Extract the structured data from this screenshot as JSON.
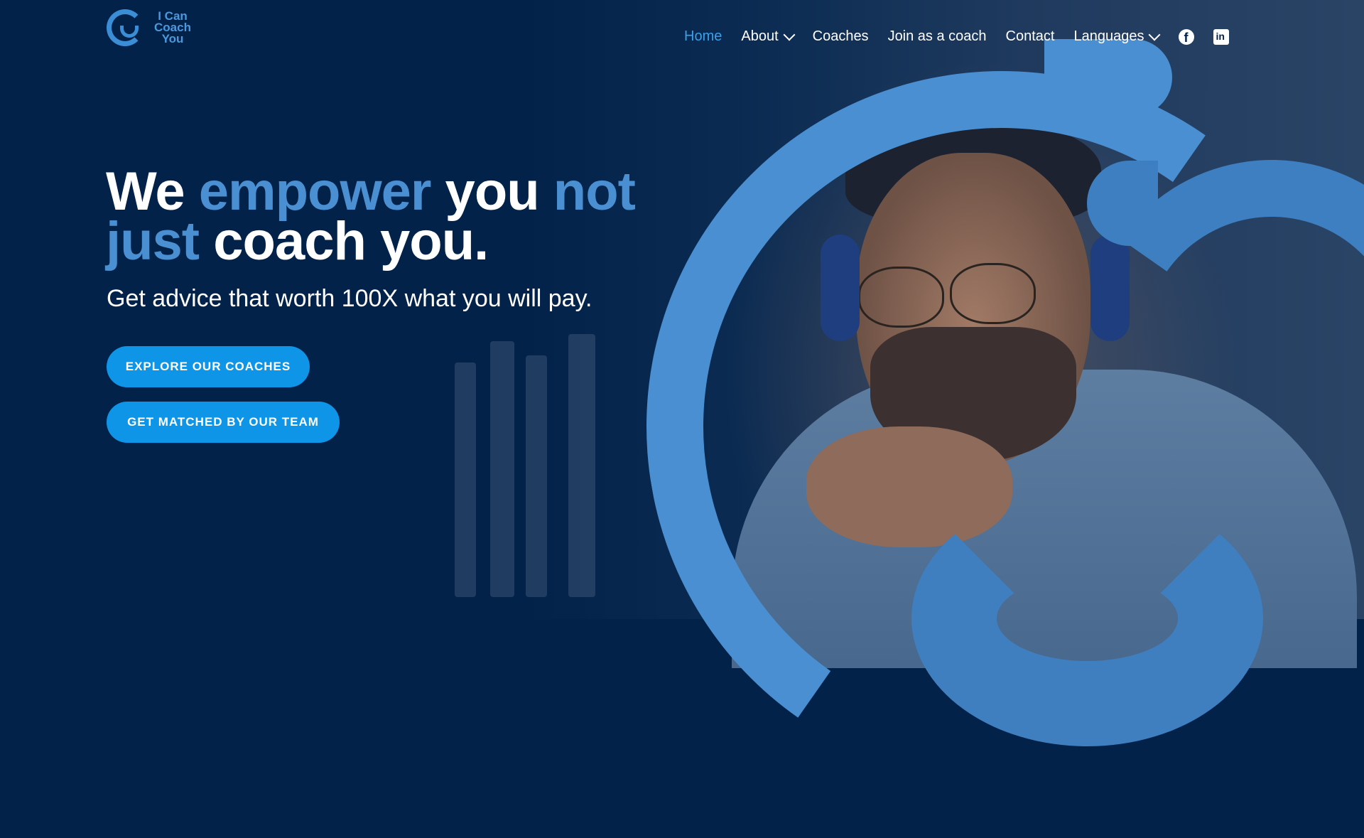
{
  "brand": {
    "logo_text": "I Can Coach You",
    "logo_color": "#3b8ed6"
  },
  "nav": {
    "items": [
      {
        "label": "Home",
        "active": true
      },
      {
        "label": "About",
        "dropdown": true
      },
      {
        "label": "Coaches"
      },
      {
        "label": "Join as a coach"
      },
      {
        "label": "Contact"
      },
      {
        "label": "Languages",
        "dropdown": true
      }
    ],
    "social": [
      "facebook-icon",
      "linkedin-icon"
    ],
    "active_color": "#3aa0ea"
  },
  "hero": {
    "headline": {
      "w1": "We",
      "w2": "empower",
      "w3": "you",
      "w4": "not",
      "w5": "just",
      "w6": "coach you."
    },
    "subtitle": "Get advice that worth 100X what you will pay.",
    "buttons": {
      "primary": "EXPLORE OUR COACHES",
      "secondary": "GET MATCHED BY OUR TEAM"
    }
  },
  "colors": {
    "background": "#02224a",
    "accent": "#4a8fd1",
    "button": "#0f95e8"
  }
}
